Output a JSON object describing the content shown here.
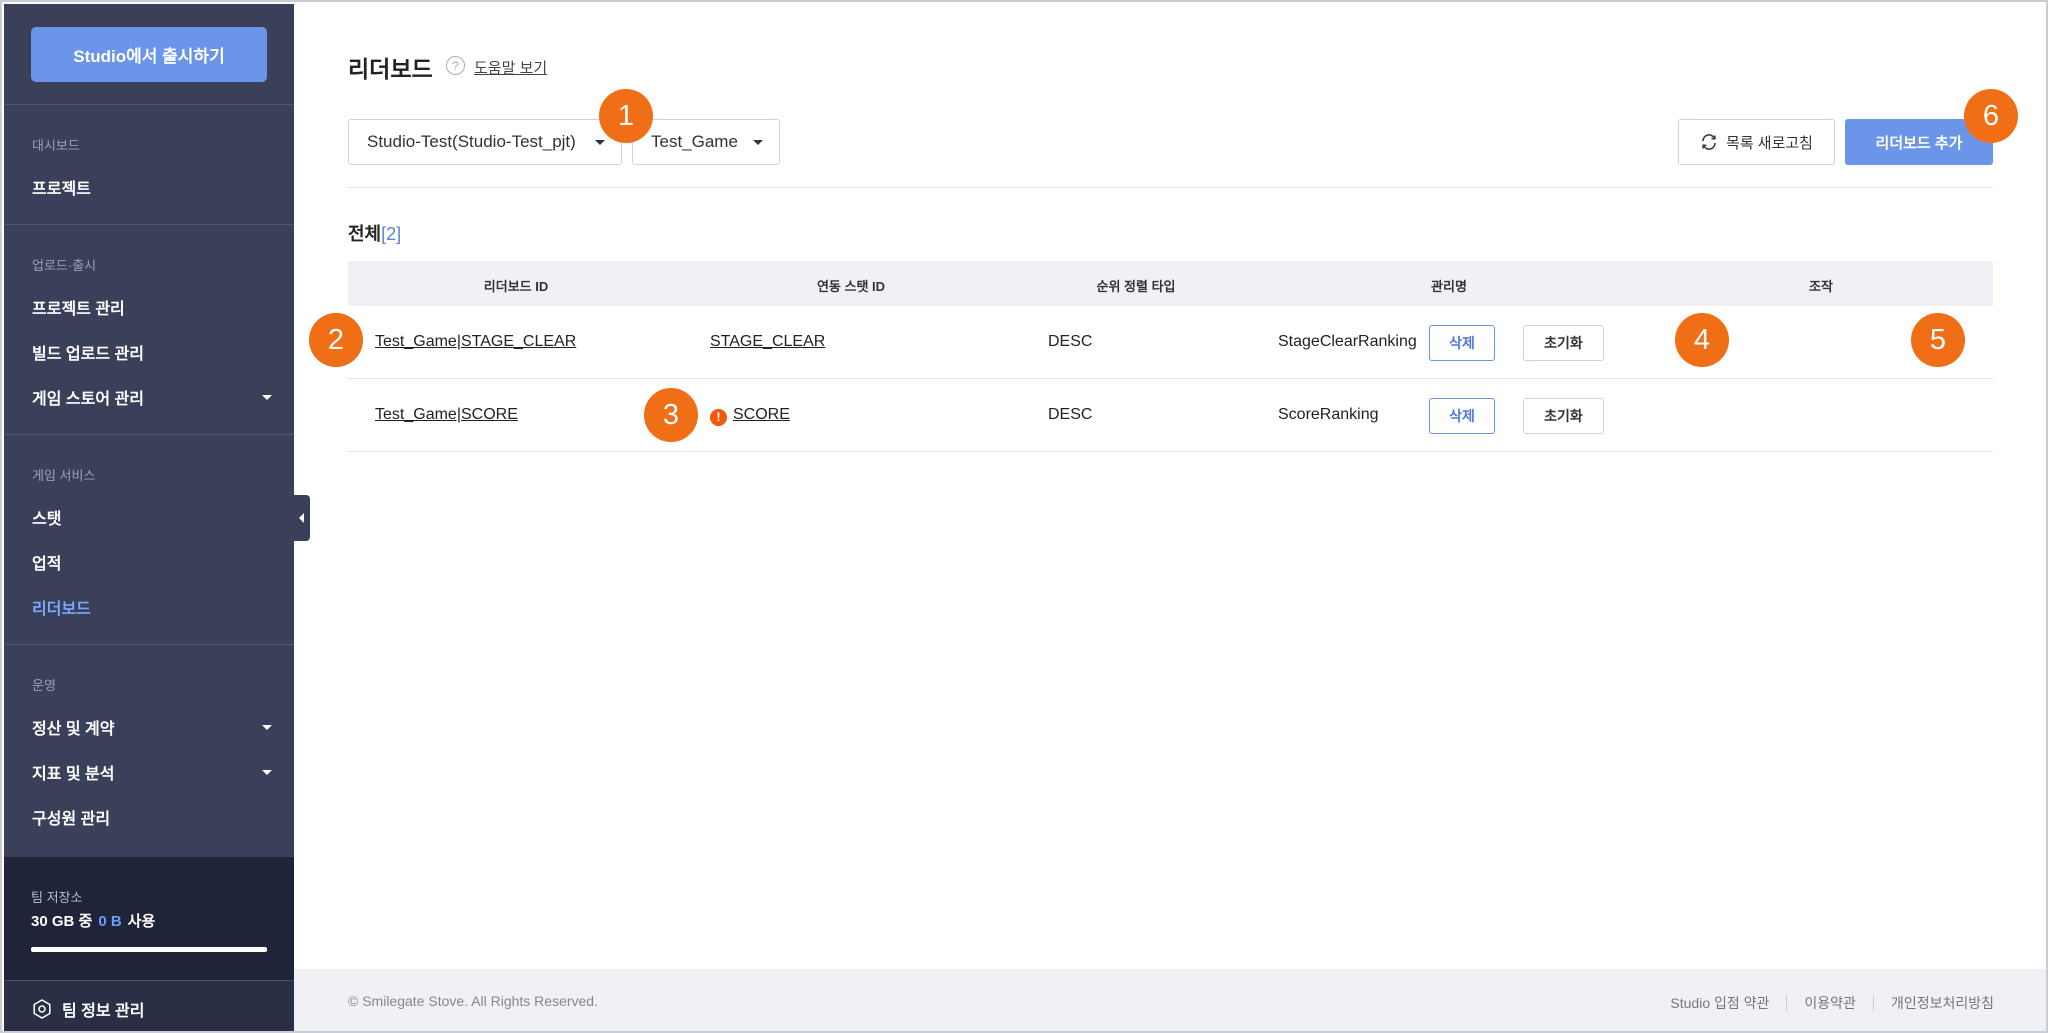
{
  "sidebar": {
    "release_button": "Studio에서 출시하기",
    "sections": {
      "dashboard": "대시보드",
      "upload": "업로드·출시",
      "game_service": "게임 서비스",
      "operation": "운영"
    },
    "items": {
      "project": "프로젝트",
      "project_manage": "프로젝트 관리",
      "build_upload": "빌드 업로드 관리",
      "store_manage": "게임 스토어 관리",
      "stat": "스탯",
      "achievement": "업적",
      "leaderboard": "리더보드",
      "settlement": "정산 및 계약",
      "metrics": "지표 및 분석",
      "members": "구성원 관리"
    },
    "storage": {
      "title": "팀 저장소",
      "total": "30 GB 중",
      "used": "0 B",
      "suffix": "사용",
      "used_fraction": 0
    },
    "team_info": "팀 정보 관리"
  },
  "page": {
    "title": "리더보드",
    "help_icon": "?",
    "help_link": "도움말 보기",
    "project_select": "Studio-Test(Studio-Test_pjt)",
    "game_select": "Test_Game",
    "refresh_button": "목록 새로고침",
    "add_button": "리더보드 추가",
    "total_label": "전체",
    "total_count": "[2]"
  },
  "table": {
    "headers": {
      "id": "리더보드 ID",
      "stat_id": "연동 스탯 ID",
      "sort": "순위 정렬 타입",
      "name": "관리명",
      "action": "조작"
    },
    "rows": [
      {
        "id": "Test_Game|STAGE_CLEAR",
        "stat_id": "STAGE_CLEAR",
        "warning": false,
        "sort": "DESC",
        "name": "StageClearRanking",
        "delete": "삭제",
        "reset": "초기화"
      },
      {
        "id": "Test_Game|SCORE",
        "stat_id": "SCORE",
        "warning": true,
        "warning_icon": "!",
        "sort": "DESC",
        "name": "ScoreRanking",
        "delete": "삭제",
        "reset": "초기화"
      }
    ]
  },
  "footer": {
    "copyright": "© Smilegate Stove. All Rights Reserved.",
    "links": [
      "Studio 입점 약관",
      "이용약관",
      "개인정보처리방침"
    ]
  },
  "callouts": [
    "1",
    "2",
    "3",
    "4",
    "5",
    "6"
  ],
  "colors": {
    "sidebar_bg": "#3a4059",
    "accent": "#6b95e8",
    "active_menu": "#7ea7ff",
    "callout": "#f06e15",
    "warning": "#f05a0a"
  }
}
